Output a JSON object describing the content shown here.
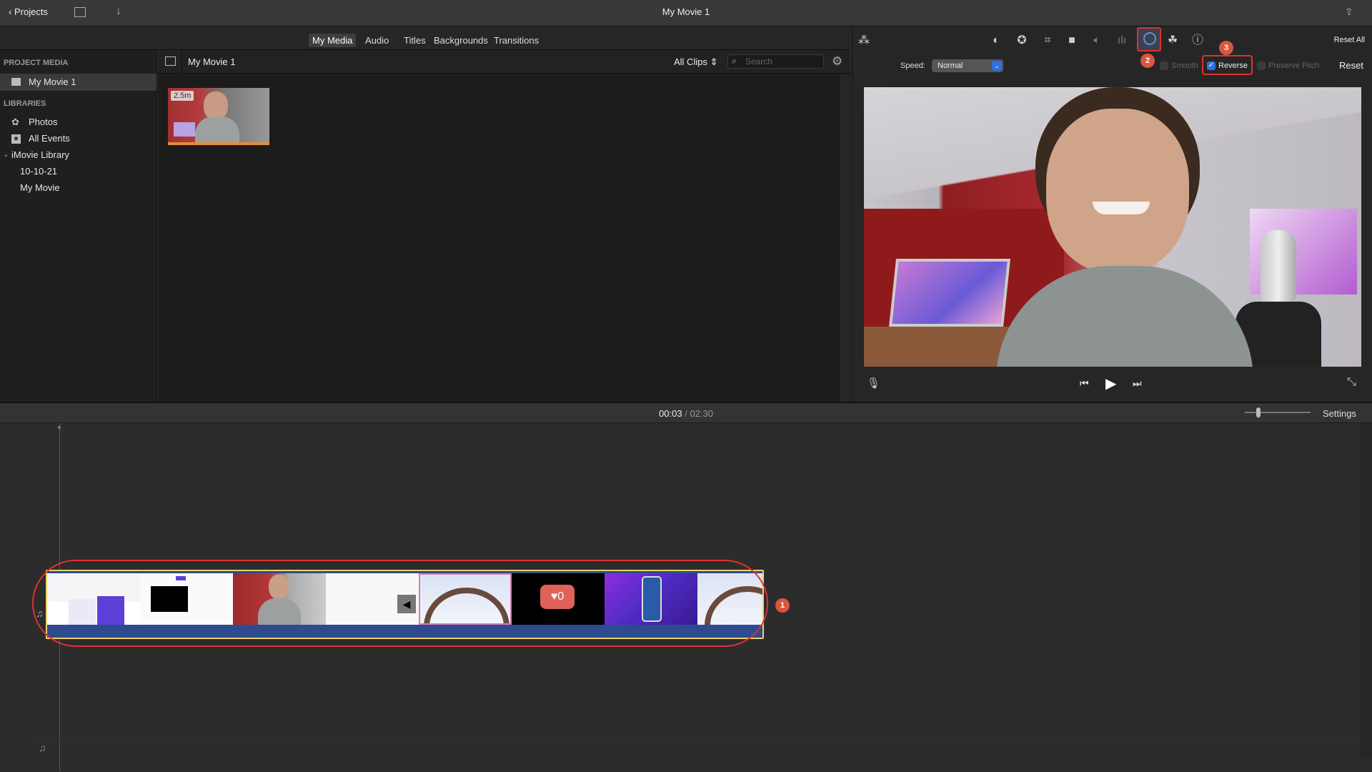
{
  "window": {
    "title": "My Movie 1",
    "projects_label": "Projects"
  },
  "tabs": [
    {
      "label": "My Media",
      "active": true
    },
    {
      "label": "Audio"
    },
    {
      "label": "Titles"
    },
    {
      "label": "Backgrounds"
    },
    {
      "label": "Transitions"
    }
  ],
  "sidebar": {
    "project_media_header": "PROJECT MEDIA",
    "project_item": "My Movie 1",
    "libraries_header": "LIBRARIES",
    "items": [
      {
        "label": "Photos",
        "icon": "photos-icon"
      },
      {
        "label": "All Events",
        "icon": "star-icon"
      },
      {
        "label": "iMovie Library",
        "icon": "chevron-down-icon"
      },
      {
        "label": "10-10-21"
      },
      {
        "label": "My Movie"
      }
    ]
  },
  "browser": {
    "title": "My Movie 1",
    "filter": "All Clips",
    "search_placeholder": "Search",
    "clip_duration": "2.5m"
  },
  "viewer": {
    "reset_all": "Reset All",
    "speed_label": "Speed:",
    "speed_value": "Normal",
    "smooth": {
      "label": "Smooth",
      "checked": false,
      "enabled": false
    },
    "reverse": {
      "label": "Reverse",
      "checked": true
    },
    "preserve_pitch": {
      "label": "Preserve Pitch",
      "checked": false,
      "enabled": false
    },
    "reset": "Reset"
  },
  "timeline": {
    "current": "00:03",
    "separator": "/",
    "total": "02:30",
    "settings": "Settings"
  },
  "annotations": [
    "1",
    "2",
    "3"
  ],
  "colors": {
    "annotation": "#d9573f",
    "highlight": "#e0312e",
    "clip_border": "#e8d36a",
    "clip_audio": "#2f4b8f",
    "accent": "#2f6fe0"
  }
}
